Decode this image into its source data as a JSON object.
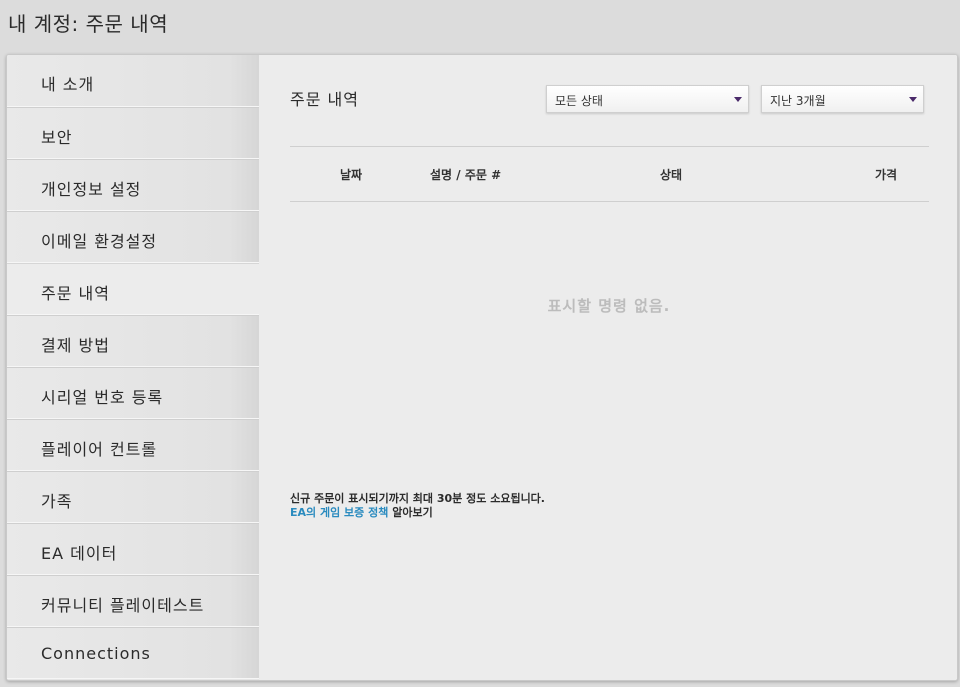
{
  "page": {
    "title": "내 계정: 주문 내역"
  },
  "sidebar": {
    "items": [
      {
        "label": "내 소개"
      },
      {
        "label": "보안"
      },
      {
        "label": "개인정보 설정"
      },
      {
        "label": "이메일 환경설정"
      },
      {
        "label": "주문 내역",
        "active": true
      },
      {
        "label": "결제 방법"
      },
      {
        "label": "시리얼 번호 등록"
      },
      {
        "label": "플레이어 컨트롤"
      },
      {
        "label": "가족"
      },
      {
        "label": "EA 데이터"
      },
      {
        "label": "커뮤니티 플레이테스트"
      },
      {
        "label": "Connections"
      }
    ]
  },
  "main": {
    "section_title": "주문 내역",
    "filters": {
      "status": {
        "selected": "모든 상태"
      },
      "period": {
        "selected": "지난 3개월"
      }
    },
    "table": {
      "columns": [
        "날짜",
        "설명 / 주문 #",
        "상태",
        "가격"
      ],
      "rows": []
    },
    "empty_message": "표시할 명령 없음.",
    "footnote": {
      "notice": "신규 주문이 표시되기까지 최대 30분 정도 소요됩니다.",
      "link_text": "EA의 게임 보증 정책",
      "link_suffix": "알아보기"
    }
  },
  "colors": {
    "background": "#dcdcdc",
    "panel": "#ececec",
    "link": "#2a8bbf",
    "caret": "#4a2a6a",
    "empty_text": "#bcbcbc"
  }
}
